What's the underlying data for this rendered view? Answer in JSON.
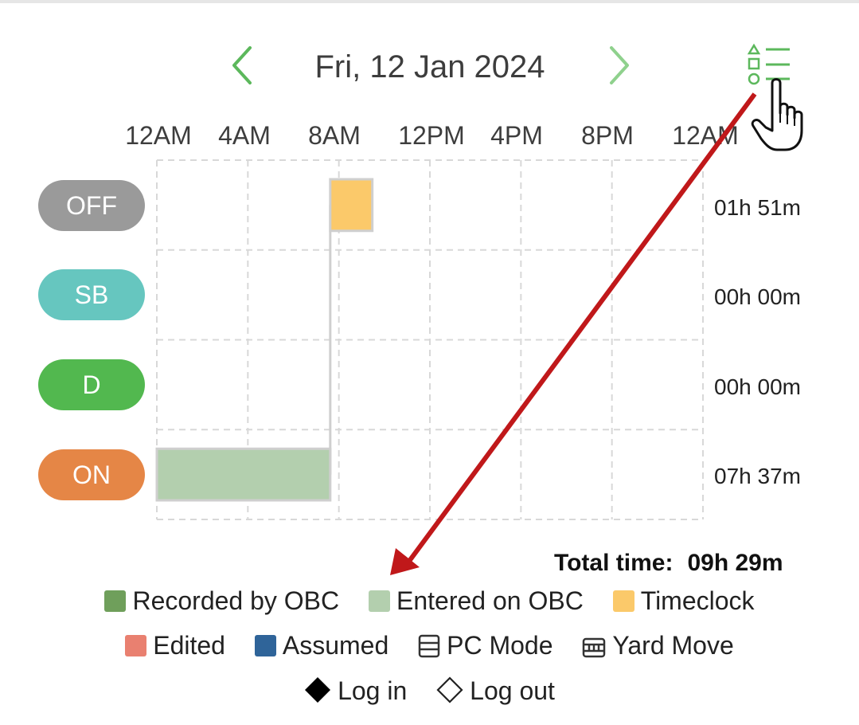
{
  "header": {
    "date": "Fri, 12 Jan 2024",
    "accent_color": "#5cb85c",
    "prev_icon": "chevron-left-icon",
    "next_icon": "chevron-right-icon",
    "legend_icon": "legend-list-icon"
  },
  "hour_labels": [
    "12AM",
    "4AM",
    "8AM",
    "12PM",
    "4PM",
    "8PM",
    "12AM"
  ],
  "rows": [
    {
      "status": "OFF",
      "color": "#9a9a9a",
      "duration": "01h 51m"
    },
    {
      "status": "SB",
      "color": "#66c6bf",
      "duration": "00h 00m"
    },
    {
      "status": "D",
      "color": "#52b84f",
      "duration": "00h 00m"
    },
    {
      "status": "ON",
      "color": "#e58646",
      "duration": "07h 37m"
    }
  ],
  "chart_data": {
    "type": "timeline",
    "x_range_hours": [
      0,
      24
    ],
    "segments": [
      {
        "status": "ON",
        "start_hour": 0.0,
        "end_hour": 7.62,
        "source": "Entered on OBC",
        "color": "#b3cfae"
      },
      {
        "status": "OFF",
        "start_hour": 7.62,
        "end_hour": 9.47,
        "source": "Timeclock",
        "color": "#fbc96a"
      }
    ]
  },
  "total": {
    "label": "Total time:",
    "value": "09h 29m"
  },
  "legend": {
    "row1": [
      {
        "label": "Recorded by OBC",
        "color": "#6f9f5b"
      },
      {
        "label": "Entered on OBC",
        "color": "#b3cfae"
      },
      {
        "label": "Timeclock",
        "color": "#fbc96a"
      }
    ],
    "row2": [
      {
        "label": "Edited",
        "color": "#e98070"
      },
      {
        "label": "Assumed",
        "color": "#2f6499"
      },
      {
        "label": "PC Mode",
        "icon": "pc-mode-icon"
      },
      {
        "label": "Yard Move",
        "icon": "yard-move-icon"
      }
    ],
    "row3": [
      {
        "label": "Log in",
        "icon": "diamond-filled-icon"
      },
      {
        "label": "Log out",
        "icon": "diamond-outline-icon"
      }
    ]
  },
  "annotation": {
    "arrow_color": "#c0181a",
    "cursor_icon": "hand-pointer-icon"
  }
}
